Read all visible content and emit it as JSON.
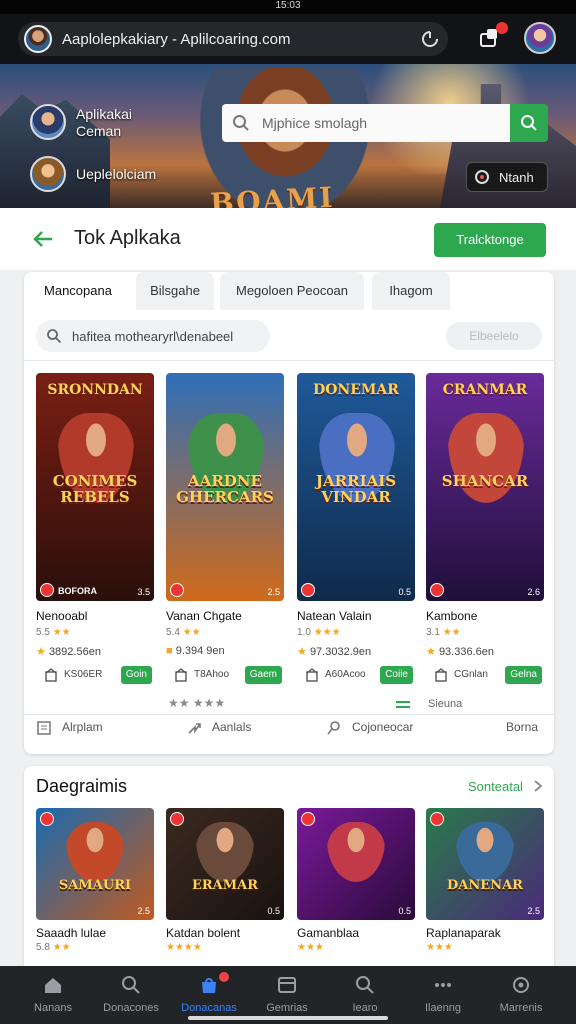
{
  "status_bar": {
    "time": "15:03"
  },
  "browser": {
    "url": "Aaplolepkakiary - Aplilcoaring.com",
    "refresh_icon": "refresh-icon",
    "notification_icon": "notification-icon",
    "avatar": "user-avatar"
  },
  "hero": {
    "profiles": [
      {
        "name": "Aplikakai\nCeman"
      },
      {
        "name": "Ueplelolciam"
      }
    ],
    "search_placeholder": "Mjphice smolagh",
    "chip_label": "Ntanh",
    "banner_text": "BOAMI"
  },
  "page": {
    "title": "Tok Aplkaka",
    "primary_button": "Tralcktonge"
  },
  "tabs": [
    "Mancopana",
    "Bilsgahe",
    "Megoloen Peocoan",
    "Ihagom"
  ],
  "card_search": {
    "placeholder": "hafitea mothearyrl\\denabeel",
    "right_pill": "Elbeelelo"
  },
  "games": [
    {
      "art_top": "SRONNDAN",
      "art_mid": "CONIMES\nREBELS",
      "badge": "BOFORA",
      "corner": "3.5",
      "name": "Nenooabl",
      "sub": "5.5",
      "stars": "★★",
      "price": "3892.56en",
      "price_icon": "★",
      "action_icon": "home-icon",
      "action_text": "KS06ER",
      "button": "Goin",
      "colors": {
        "bg1": "#7a1f14",
        "bg2": "#2a0f0a",
        "fig": "#b23a2a"
      }
    },
    {
      "art_top": "",
      "art_mid": "AARDNE\nGHERCARS",
      "badge": "",
      "corner": "2.5",
      "name": "Vanan Chgate",
      "sub": "5.4",
      "stars": "★★",
      "price": "9.394 9en",
      "price_icon": "■",
      "action_icon": "box-icon",
      "action_text": "T8Ahoo",
      "button": "Gaem",
      "colors": {
        "bg1": "#2f6fb8",
        "bg2": "#d06a1a",
        "fig": "#3d8f4a"
      }
    },
    {
      "art_top": "DONEMAR",
      "art_mid": "JARRIAIS\nVINDAR",
      "badge": "",
      "corner": "0.5",
      "name": "Natean Valain",
      "sub": "1.0",
      "stars": "★★★",
      "price": "97.3032.9en",
      "price_icon": "★",
      "action_icon": "lock-icon",
      "action_text": "A60Acoo",
      "button": "Coiie",
      "colors": {
        "bg1": "#1f5a9a",
        "bg2": "#0f2a4a",
        "fig": "#4a6ec2"
      }
    },
    {
      "art_top": "CRANMAR",
      "art_mid": "SHANCAR",
      "badge": "",
      "corner": "2.6",
      "name": "Kambone",
      "sub": "3.1",
      "stars": "★★",
      "price": "93.336.6en",
      "price_icon": "★",
      "action_icon": "triangle-icon",
      "action_text": "CGnlan",
      "button": "Gelna",
      "colors": {
        "bg1": "#6a2a9a",
        "bg2": "#1f0f3a",
        "fig": "#c2463a"
      }
    }
  ],
  "card_extra_row": {
    "stars_a": "★★ ★★★",
    "icon_c": "equals-icon",
    "label_d": "Sieuna"
  },
  "card_footer": [
    {
      "icon": "document-icon",
      "label": "Alrplam"
    },
    {
      "icon": "share-icon",
      "label": "Aanlals"
    },
    {
      "icon": "search-icon",
      "label": "Cojoneocar"
    },
    {
      "icon": "",
      "label": "Borna"
    }
  ],
  "section": {
    "title": "Daegraimis",
    "link": "Sonteatal",
    "games": [
      {
        "art": "SAMAURI",
        "corner": "2.5",
        "name": "Saaadh lulae",
        "sub": "5.8",
        "stars": "★★",
        "colors": {
          "bg1": "#1a6ab0",
          "bg2": "#c05a20",
          "fig": "#c24a2a"
        }
      },
      {
        "art": "ERAMAR",
        "corner": "0.5",
        "name": "Katdan bolent",
        "sub": "",
        "stars": "★★★★",
        "colors": {
          "bg1": "#3a2a20",
          "bg2": "#1a1210",
          "fig": "#6a4a3a"
        }
      },
      {
        "art": "",
        "corner": "0.5",
        "name": "Gamanblaa",
        "sub": "",
        "stars": "★★★",
        "colors": {
          "bg1": "#7a1a9a",
          "bg2": "#2a0a3a",
          "fig": "#c23a4a"
        }
      },
      {
        "art": "DANENAR",
        "corner": "2.5",
        "name": "Raplanaparak",
        "sub": "",
        "stars": "★★★",
        "colors": {
          "bg1": "#2a7a4a",
          "bg2": "#4a2a7a",
          "fig": "#3a6a9a"
        }
      }
    ]
  },
  "bottom_nav": [
    {
      "icon": "home-icon",
      "label": "Nanans",
      "active": false
    },
    {
      "icon": "search-icon",
      "label": "Donacones",
      "active": false
    },
    {
      "icon": "store-icon",
      "label": "Donacanas",
      "active": true
    },
    {
      "icon": "card-icon",
      "label": "Gemrias",
      "active": false
    },
    {
      "icon": "search-icon",
      "label": "Iearo",
      "active": false
    },
    {
      "icon": "more-icon",
      "label": "Ilaenng",
      "active": false
    },
    {
      "icon": "settings-icon",
      "label": "Marrenis",
      "active": false
    }
  ],
  "accent_colors": {
    "green": "#2ea84f",
    "blue": "#3b82f6"
  }
}
